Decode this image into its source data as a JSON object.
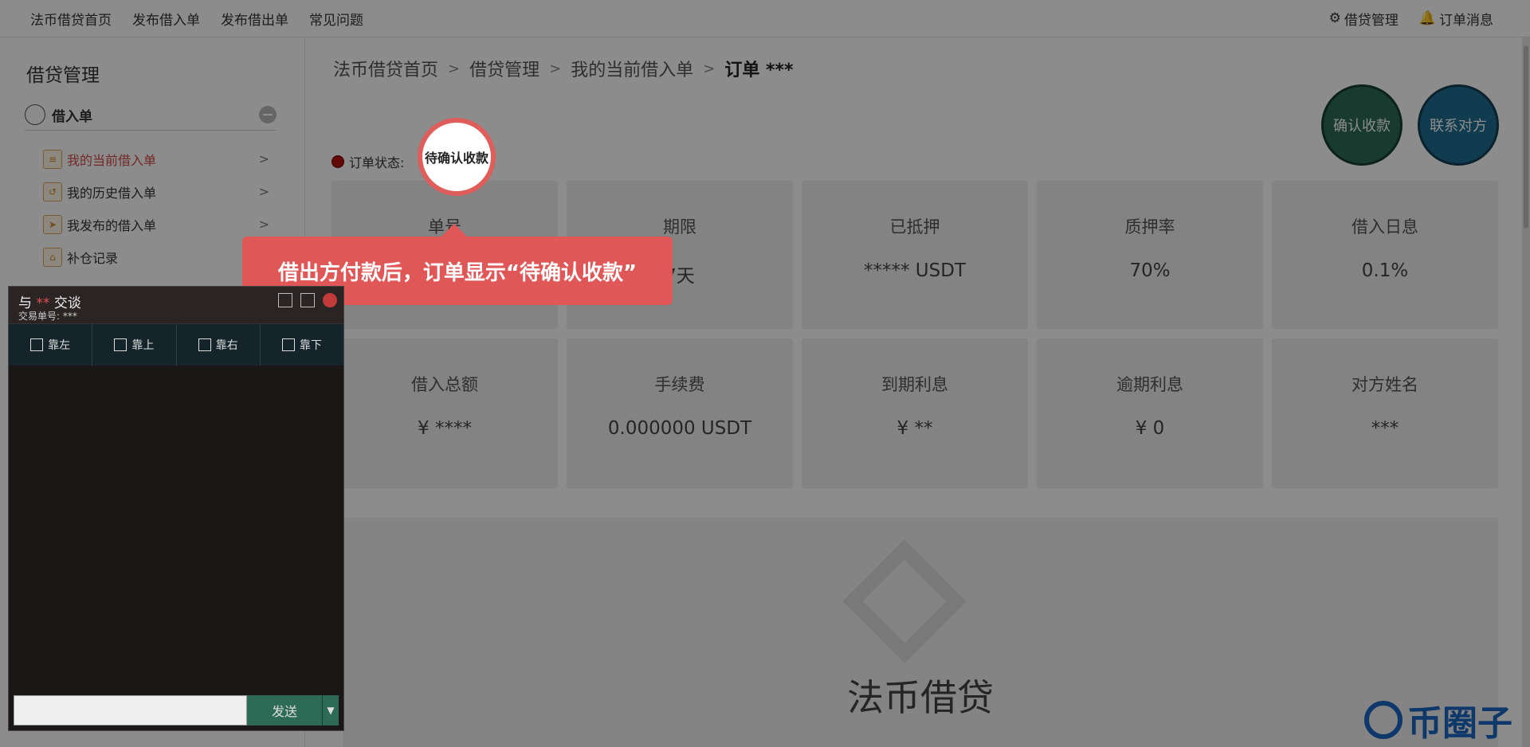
{
  "topnav": {
    "links": [
      "法币借贷首页",
      "发布借入单",
      "发布借出单",
      "常见问题"
    ],
    "right": [
      {
        "icon": "gear-icon",
        "label": "借贷管理"
      },
      {
        "icon": "bell-icon",
        "label": "订单消息"
      }
    ]
  },
  "sidebar": {
    "title": "借贷管理",
    "group_label": "借入单",
    "items": [
      {
        "label": "我的当前借入单",
        "chevron": ">",
        "active": true
      },
      {
        "label": "我的历史借入单",
        "chevron": ">"
      },
      {
        "label": "我发布的借入单",
        "chevron": ">"
      },
      {
        "label": "补仓记录",
        "chevron": ""
      }
    ]
  },
  "breadcrumb": {
    "items": [
      "法币借贷首页",
      "借贷管理",
      "我的当前借入单"
    ],
    "separator": ">",
    "current": "订单 ***"
  },
  "actions": {
    "confirm": "确认收款",
    "contact": "联系对方"
  },
  "status": {
    "label": "订单状态:",
    "value": "待确认收款"
  },
  "cards_row1": [
    {
      "label": "单号",
      "value": ""
    },
    {
      "label": "期限",
      "value": "7天"
    },
    {
      "label": "已抵押",
      "value": "*****  USDT"
    },
    {
      "label": "质押率",
      "value": "70%"
    },
    {
      "label": "借入日息",
      "value": "0.1%"
    }
  ],
  "cards_row2": [
    {
      "label": "借入总额",
      "value": "¥ ****"
    },
    {
      "label": "手续费",
      "value": "0.000000 USDT"
    },
    {
      "label": "到期利息",
      "value": "¥ **"
    },
    {
      "label": "逾期利息",
      "value": "¥ 0"
    },
    {
      "label": "对方姓名",
      "value": "***"
    }
  ],
  "brand": "法币借贷",
  "watermark": "币圈子",
  "tooltip": "借出方付款后，订单显示“待确认收款”",
  "chat": {
    "title_prefix": "与",
    "title_stars": "**",
    "title_suffix": "交谈",
    "sub_label": "交易单号:",
    "sub_value": "***",
    "dock": [
      "靠左",
      "靠上",
      "靠右",
      "靠下"
    ],
    "send": "发送",
    "send_drop": "▼"
  }
}
